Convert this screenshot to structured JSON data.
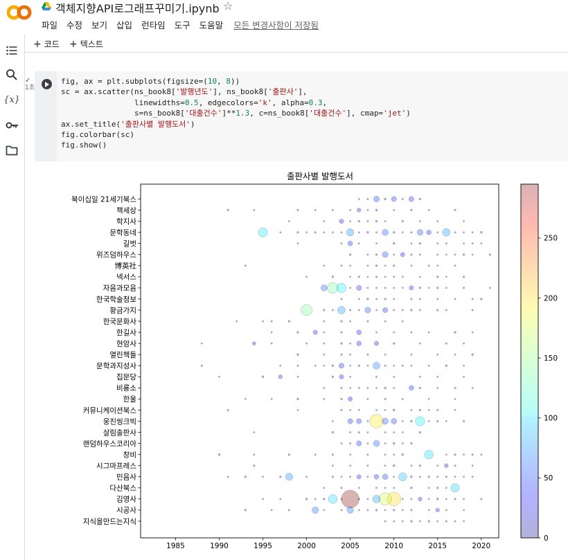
{
  "header": {
    "title": "객체지향API로그래프꾸미기.ipynb",
    "menu": [
      "파일",
      "수정",
      "보기",
      "삽입",
      "런타임",
      "도구",
      "도움말"
    ],
    "save_status": "모든 변경사항이 저장됨"
  },
  "toolbar": {
    "code_label": "코드",
    "text_label": "텍스트"
  },
  "sidebar": {
    "icons": [
      "table-of-contents-icon",
      "search-icon",
      "variables-icon",
      "secrets-key-icon",
      "files-folder-icon"
    ]
  },
  "cell": {
    "exec_time": "1초",
    "code_lines": [
      "fig, ax = plt.subplots(figsize=(10, 8))",
      "sc = ax.scatter(ns_book8['발행년도'], ns_book8['출판사'],",
      "                linewidths=0.5, edgecolors='k', alpha=0.3,",
      "                s=ns_book8['대출건수']**1.3, c=ns_book8['대출건수'], cmap='jet')",
      "ax.set_title('출판사별 발행도서')",
      "fig.colorbar(sc)",
      "fig.show()"
    ]
  },
  "colors": {
    "accent": "#f9ab00",
    "run_button": "#3c4043"
  },
  "chart_data": {
    "type": "scatter",
    "title": "출판사별 발행도서",
    "xlabel": "",
    "ylabel": "",
    "xlim": [
      1981,
      2022
    ],
    "xticks": [
      1985,
      1990,
      1995,
      2000,
      2005,
      2010,
      2015,
      2020
    ],
    "categories": [
      "북이십일 21세기북스",
      "책세상",
      "학지사",
      "문학동네",
      "길벗",
      "위즈덤하우스",
      "博英社",
      "넥서스",
      "자음과모음",
      "한국학술정보",
      "황금가지",
      "한국문화사",
      "한길사",
      "현암사",
      "열린책들",
      "문학과지성사",
      "집문당",
      "비룡소",
      "한울",
      "커뮤니케이션북스",
      "웅진씽크빅",
      "살림출판사",
      "랜덤하우스코리아",
      "창비",
      "시그마프레스",
      "민음사",
      "다산북스",
      "김영사",
      "시공사",
      "지식을만드는지식"
    ],
    "colorbar": {
      "min": 0,
      "max": 295,
      "ticks": [
        0,
        50,
        100,
        150,
        200,
        250
      ],
      "cmap": "jet"
    },
    "points": [
      {
        "x": 2005,
        "cat": "김영사",
        "v": 295
      },
      {
        "x": 2008,
        "cat": "웅진씽크빅",
        "v": 190
      },
      {
        "x": 2010,
        "cat": "김영사",
        "v": 195
      },
      {
        "x": 2009,
        "cat": "김영사",
        "v": 170
      },
      {
        "x": 2003,
        "cat": "자음과모음",
        "v": 140
      },
      {
        "x": 2004,
        "cat": "자음과모음",
        "v": 110
      },
      {
        "x": 2000,
        "cat": "황금가지",
        "v": 140
      },
      {
        "x": 1995,
        "cat": "문학동네",
        "v": 105
      },
      {
        "x": 2013,
        "cat": "웅진씽크빅",
        "v": 110
      },
      {
        "x": 2014,
        "cat": "창비",
        "v": 100
      },
      {
        "x": 2017,
        "cat": "다산북스",
        "v": 95
      },
      {
        "x": 2003,
        "cat": "김영사",
        "v": 100
      },
      {
        "x": 2004,
        "cat": "황금가지",
        "v": 80
      },
      {
        "x": 2005,
        "cat": "문학동네",
        "v": 75
      },
      {
        "x": 2016,
        "cat": "문학동네",
        "v": 80
      },
      {
        "x": 1998,
        "cat": "민음사",
        "v": 75
      },
      {
        "x": 2011,
        "cat": "민음사",
        "v": 90
      },
      {
        "x": 2008,
        "cat": "김영사",
        "v": 80
      },
      {
        "x": 2001,
        "cat": "시공사",
        "v": 65
      },
      {
        "x": 2008,
        "cat": "북이십일 21세기북스",
        "v": 55
      },
      {
        "x": 2008,
        "cat": "문학과지성사",
        "v": 70
      },
      {
        "x": 2009,
        "cat": "위즈덤하우스",
        "v": 55
      },
      {
        "x": 2005,
        "cat": "시공사",
        "v": 65
      },
      {
        "x": 2002,
        "cat": "자음과모음",
        "v": 60
      },
      {
        "x": 2007,
        "cat": "황금가지",
        "v": 55
      },
      {
        "x": 2006,
        "cat": "현암사",
        "v": 40
      },
      {
        "x": 2009,
        "cat": "문학동네",
        "v": 60
      },
      {
        "x": 2013,
        "cat": "문학동네",
        "v": 55
      },
      {
        "x": 2008,
        "cat": "랜덤하우스코리아",
        "v": 60
      },
      {
        "x": 2006,
        "cat": "랜덤하우스코리아",
        "v": 45
      },
      {
        "x": 2012,
        "cat": "비룡소",
        "v": 40
      },
      {
        "x": 2010,
        "cat": "북이십일 21세기북스",
        "v": 45
      },
      {
        "x": 2012,
        "cat": "북이십일 21세기북스",
        "v": 45
      },
      {
        "x": 2006,
        "cat": "자음과모음",
        "v": 45
      },
      {
        "x": 2005,
        "cat": "웅진씽크빅",
        "v": 45
      },
      {
        "x": 2009,
        "cat": "웅진씽크빅",
        "v": 60
      },
      {
        "x": 2006,
        "cat": "웅진씽크빅",
        "v": 45
      },
      {
        "x": 2010,
        "cat": "웅진씽크빅",
        "v": 50
      },
      {
        "x": 2004,
        "cat": "문학과지성사",
        "v": 45
      },
      {
        "x": 2004,
        "cat": "집문당",
        "v": 35
      },
      {
        "x": 2005,
        "cat": "한울",
        "v": 35
      },
      {
        "x": 2009,
        "cat": "민음사",
        "v": 50
      },
      {
        "x": 2008,
        "cat": "민음사",
        "v": 40
      },
      {
        "x": 2006,
        "cat": "민음사",
        "v": 35
      },
      {
        "x": 2011,
        "cat": "위즈덤하우스",
        "v": 35
      },
      {
        "x": 2009,
        "cat": "황금가지",
        "v": 45
      },
      {
        "x": 2006,
        "cat": "한길사",
        "v": 40
      },
      {
        "x": 2014,
        "cat": "문학동네",
        "v": 40
      },
      {
        "x": 2005,
        "cat": "길벗",
        "v": 40
      },
      {
        "x": 2008,
        "cat": "현암사",
        "v": 35
      },
      {
        "x": 2004,
        "cat": "학지사",
        "v": 35
      },
      {
        "x": 2006,
        "cat": "책세상",
        "v": 30
      },
      {
        "x": 2012,
        "cat": "자음과모음",
        "v": 35
      },
      {
        "x": 2001,
        "cat": "한길사",
        "v": 35
      },
      {
        "x": 1997,
        "cat": "집문당",
        "v": 30
      },
      {
        "x": 2016,
        "cat": "시그마프레스",
        "v": 30
      },
      {
        "x": 2013,
        "cat": "김영사",
        "v": 30
      },
      {
        "x": 2015,
        "cat": "시공사",
        "v": 30
      },
      {
        "x": 1994,
        "cat": "현암사",
        "v": 25
      }
    ],
    "small_points": [
      {
        "cat": "북이십일 21세기북스",
        "xs": [
          2006,
          2007,
          2009,
          2011,
          2013
        ]
      },
      {
        "cat": "책세상",
        "xs": [
          1991,
          1994,
          1999,
          2001,
          2003,
          2005,
          2007,
          2008,
          2010,
          2012,
          2014,
          2017
        ]
      },
      {
        "cat": "학지사",
        "xs": [
          1998,
          2002,
          2005,
          2006,
          2007,
          2008,
          2009,
          2011,
          2013,
          2015,
          2018
        ]
      },
      {
        "cat": "문학동네",
        "xs": [
          1997,
          1999,
          2000,
          2001,
          2002,
          2003,
          2004,
          2006,
          2007,
          2008,
          2010,
          2011,
          2012,
          2015,
          2017,
          2018,
          2019,
          2020
        ]
      },
      {
        "cat": "길벗",
        "xs": [
          1999,
          2004,
          2006,
          2008,
          2010,
          2012,
          2013,
          2015,
          2016,
          2018,
          2019,
          2020
        ]
      },
      {
        "cat": "위즈덤하우스",
        "xs": [
          2005,
          2007,
          2008,
          2010,
          2012,
          2013,
          2015,
          2016,
          2017,
          2018,
          2019,
          2021
        ]
      },
      {
        "cat": "博英社",
        "xs": [
          1993,
          2002,
          2004,
          2005,
          2007,
          2008,
          2009,
          2010,
          2012,
          2014,
          2015,
          2017
        ]
      },
      {
        "cat": "넥서스",
        "xs": [
          2000,
          2003,
          2005,
          2006,
          2007,
          2008,
          2009,
          2010,
          2011,
          2013,
          2015,
          2016,
          2018
        ]
      },
      {
        "cat": "자음과모음",
        "xs": [
          2005,
          2007,
          2008,
          2009,
          2010,
          2011,
          2013,
          2014,
          2015,
          2016,
          2018,
          2021
        ]
      },
      {
        "cat": "한국학술정보",
        "xs": [
          2004,
          2006,
          2007,
          2008,
          2009,
          2010,
          2012,
          2013,
          2015,
          2017,
          2019,
          2020
        ]
      },
      {
        "cat": "황금가지",
        "xs": [
          2002,
          2003,
          2005,
          2006,
          2008,
          2010,
          2011,
          2012,
          2013,
          2015,
          2016,
          2019
        ]
      },
      {
        "cat": "한국문화사",
        "xs": [
          1992,
          1995,
          1996,
          1998,
          2002,
          2004,
          2005,
          2007,
          2009,
          2011
        ]
      },
      {
        "cat": "한길사",
        "xs": [
          1996,
          1999,
          2002,
          2004,
          2008,
          2010,
          2012,
          2014,
          2017,
          2019
        ]
      },
      {
        "cat": "현암사",
        "xs": [
          1988,
          1996,
          2000,
          2002,
          2004,
          2005,
          2010,
          2013,
          2016,
          2018
        ]
      },
      {
        "cat": "열린책들",
        "xs": [
          1999,
          2002,
          2004,
          2005,
          2007,
          2009,
          2012,
          2015,
          2017,
          2019
        ]
      },
      {
        "cat": "문학과지성사",
        "xs": [
          1988,
          1997,
          1999,
          2001,
          2002,
          2003,
          2005,
          2006,
          2007,
          2009,
          2010,
          2011,
          2012,
          2014,
          2016,
          2018
        ]
      },
      {
        "cat": "집문당",
        "xs": [
          1990,
          1995,
          1999,
          2003,
          2005,
          2008,
          2010,
          2013,
          2015,
          2018
        ]
      },
      {
        "cat": "비룡소",
        "xs": [
          2002,
          2004,
          2005,
          2006,
          2007,
          2008,
          2009,
          2010,
          2013,
          2015,
          2017,
          2019
        ]
      },
      {
        "cat": "한울",
        "xs": [
          1993,
          1996,
          1999,
          2002,
          2004,
          2007,
          2009,
          2011,
          2014,
          2017
        ]
      },
      {
        "cat": "커뮤니케이션북스",
        "xs": [
          1991,
          1999,
          2004,
          2005,
          2006,
          2008,
          2009,
          2010,
          2012,
          2013,
          2014,
          2015,
          2017
        ]
      },
      {
        "cat": "웅진씽크빅",
        "xs": [
          2003,
          2007,
          2011,
          2012,
          2014,
          2015,
          2016,
          2018
        ]
      },
      {
        "cat": "살림출판사",
        "xs": [
          1994,
          2003,
          2005,
          2006,
          2007,
          2009,
          2010,
          2011,
          2013
        ]
      },
      {
        "cat": "랜덤하우스코리아",
        "xs": [
          2004,
          2005,
          2007,
          2009,
          2010,
          2011,
          2012
        ]
      },
      {
        "cat": "창비",
        "xs": [
          1990,
          1994,
          1998,
          2001,
          2003,
          2005,
          2007,
          2009,
          2010,
          2011,
          2016,
          2017,
          2018,
          2019,
          2020
        ]
      },
      {
        "cat": "시그마프레스",
        "xs": [
          1994,
          2003,
          2005,
          2007,
          2009,
          2010,
          2012,
          2013,
          2015,
          2017,
          2019
        ]
      },
      {
        "cat": "민음사",
        "xs": [
          1991,
          1993,
          1995,
          1997,
          2000,
          2003,
          2004,
          2005,
          2007,
          2010,
          2012,
          2013,
          2014,
          2015,
          2016,
          2017,
          2018,
          2019
        ]
      },
      {
        "cat": "다산북스",
        "xs": [
          2002,
          2004,
          2006,
          2008,
          2009,
          2010,
          2012,
          2014,
          2015,
          2016
        ]
      },
      {
        "cat": "김영사",
        "xs": [
          1995,
          1997,
          2000,
          2001,
          2002,
          2004,
          2006,
          2007,
          2011,
          2012,
          2014,
          2015,
          2016,
          2017,
          2018,
          2020
        ]
      },
      {
        "cat": "시공사",
        "xs": [
          1993,
          1996,
          1998,
          2002,
          2004,
          2006,
          2007,
          2008,
          2009,
          2010,
          2011,
          2012,
          2014,
          2016,
          2018
        ]
      },
      {
        "cat": "지식을만드는지식",
        "xs": [
          2009,
          2010,
          2011,
          2012,
          2013,
          2014,
          2015,
          2016,
          2017,
          2018
        ]
      }
    ]
  }
}
